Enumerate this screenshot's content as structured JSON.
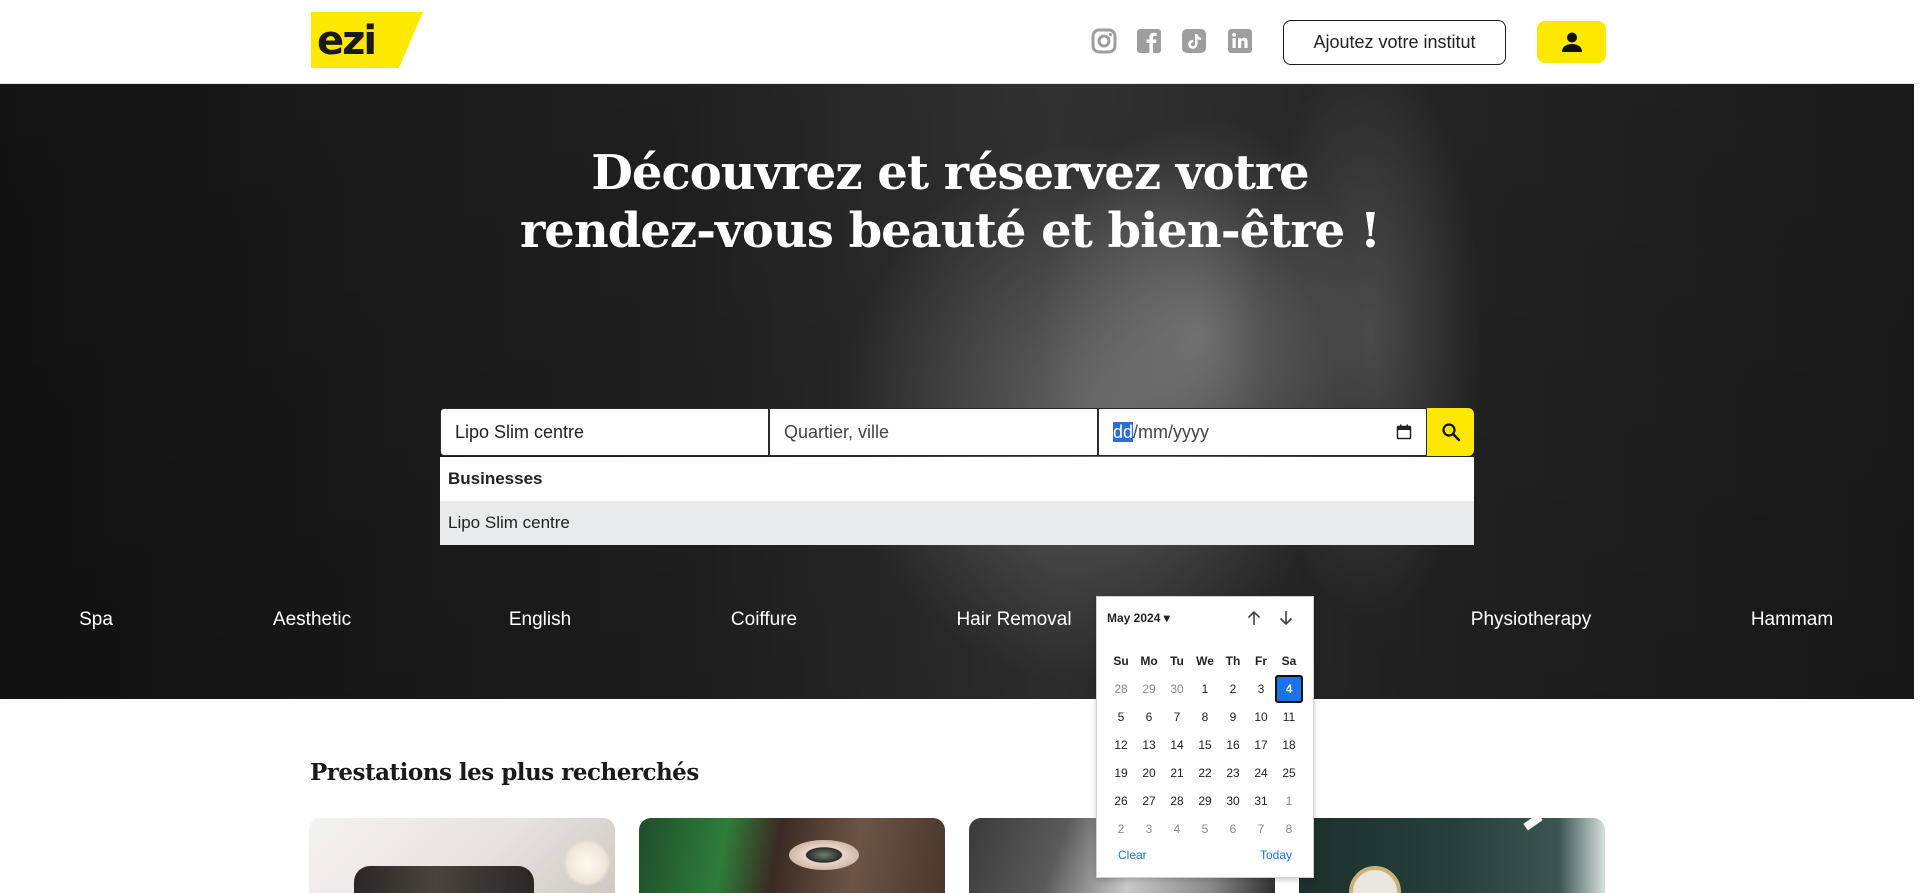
{
  "header": {
    "logo_text": "ezi",
    "add_institute_label": "Ajoutez votre institut",
    "social_icons": [
      "instagram-icon",
      "facebook-icon",
      "tiktok-icon",
      "linkedin-icon"
    ],
    "user_icon": "user-icon"
  },
  "hero": {
    "title_line1": "Découvrez et réservez votre",
    "title_line2": "rendez-vous beauté et bien-être !"
  },
  "search": {
    "what_value": "Lipo Slim centre",
    "where_placeholder": "Quartier, ville",
    "date_day": "dd",
    "date_rest": "/mm/yyyy",
    "search_icon": "search-icon"
  },
  "suggestions": {
    "heading": "Businesses",
    "items": [
      "Lipo Slim centre"
    ]
  },
  "categories": [
    "Spa",
    "Aesthetic",
    "English",
    "Coiffure",
    "Hair Removal",
    "Physiotherapy",
    "Hammam"
  ],
  "datepicker": {
    "month_label": "May 2024",
    "weekdays": [
      "Su",
      "Mo",
      "Tu",
      "We",
      "Th",
      "Fr",
      "Sa"
    ],
    "weeks": [
      [
        "28",
        "29",
        "30",
        "1",
        "2",
        "3",
        "4"
      ],
      [
        "5",
        "6",
        "7",
        "8",
        "9",
        "10",
        "11"
      ],
      [
        "12",
        "13",
        "14",
        "15",
        "16",
        "17",
        "18"
      ],
      [
        "19",
        "20",
        "21",
        "22",
        "23",
        "24",
        "25"
      ],
      [
        "26",
        "27",
        "28",
        "29",
        "30",
        "31",
        "1"
      ],
      [
        "2",
        "3",
        "4",
        "5",
        "6",
        "7",
        "8"
      ]
    ],
    "selected_day": "4",
    "clear_label": "Clear",
    "today_label": "Today"
  },
  "services": {
    "title": "Prestations les plus recherchés"
  },
  "colors": {
    "brand_yellow": "#ffe800",
    "selection_blue": "#1a73e8",
    "dark_text": "#1a1a1a"
  }
}
